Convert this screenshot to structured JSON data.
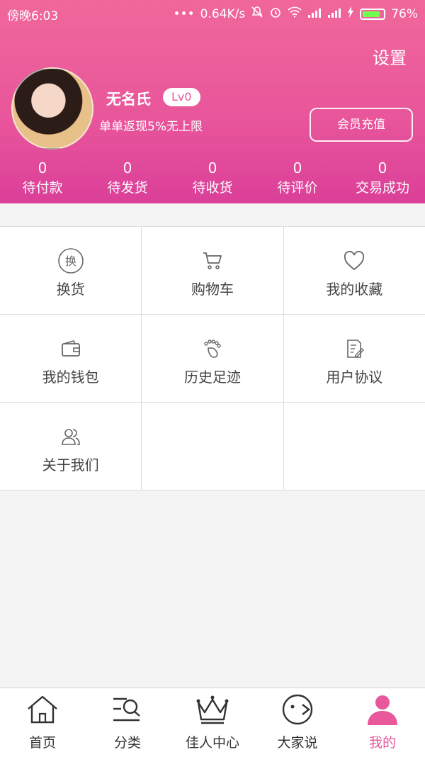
{
  "status_bar": {
    "time": "傍晚6:03",
    "speed": "0.64K/s",
    "battery": "76%",
    "icons": [
      "dots-icon",
      "mute-icon",
      "alarm-icon",
      "wifi-icon",
      "signal-icon",
      "signal-icon",
      "charging-icon",
      "battery-icon"
    ]
  },
  "profile": {
    "settings_label": "设置",
    "username": "无名氏",
    "level": "Lv0",
    "rebate_text": "单单返现5%无上限",
    "recharge_label": "会员充值"
  },
  "orders": [
    {
      "count": "0",
      "label": "待付款"
    },
    {
      "count": "0",
      "label": "待发货"
    },
    {
      "count": "0",
      "label": "待收货"
    },
    {
      "count": "0",
      "label": "待评价"
    },
    {
      "count": "0",
      "label": "交易成功"
    }
  ],
  "menu": [
    {
      "label": "换货",
      "icon": "exchange-icon",
      "icon_text": "换"
    },
    {
      "label": "购物车",
      "icon": "cart-icon"
    },
    {
      "label": "我的收藏",
      "icon": "heart-icon"
    },
    {
      "label": "我的钱包",
      "icon": "wallet-icon"
    },
    {
      "label": "历史足迹",
      "icon": "footprint-icon"
    },
    {
      "label": "用户协议",
      "icon": "agreement-icon"
    },
    {
      "label": "关于我们",
      "icon": "users-icon"
    }
  ],
  "tabs": [
    {
      "label": "首页",
      "icon": "home-icon"
    },
    {
      "label": "分类",
      "icon": "category-search-icon"
    },
    {
      "label": "佳人中心",
      "icon": "crown-icon"
    },
    {
      "label": "大家说",
      "icon": "chat-face-icon"
    },
    {
      "label": "我的",
      "icon": "person-icon",
      "active": true
    }
  ],
  "colors": {
    "accent": "#e8589a",
    "header_top": "#f0679b",
    "header_bottom": "#db3f99"
  }
}
